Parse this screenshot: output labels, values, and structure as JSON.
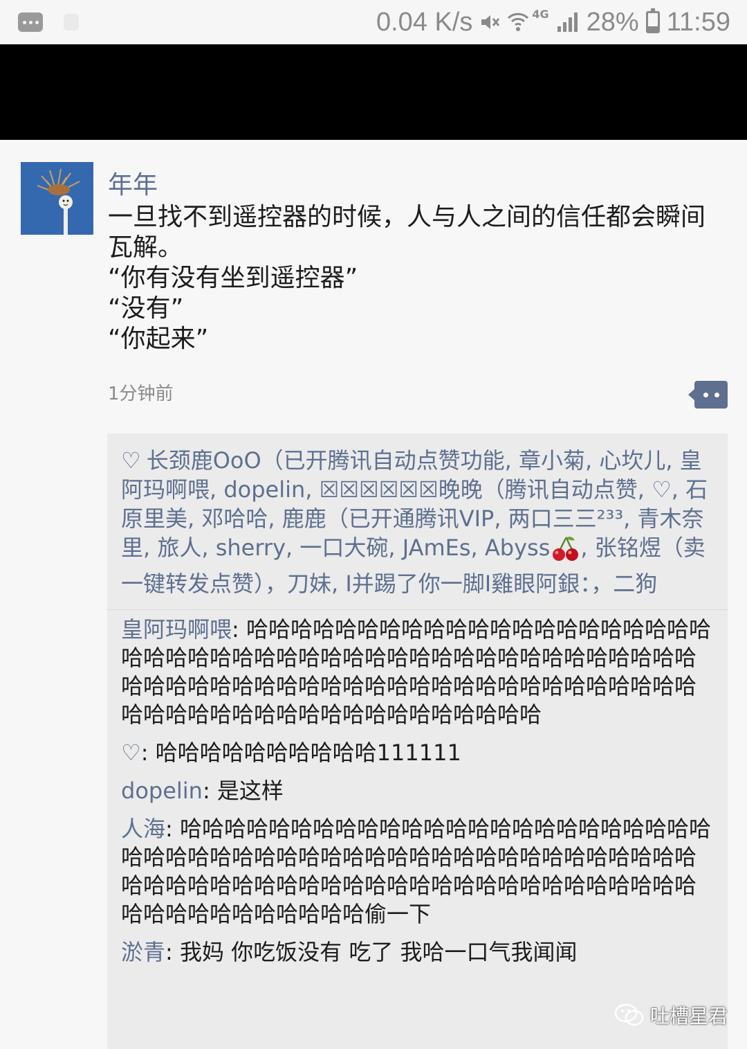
{
  "status_bar": {
    "net_speed": "0.04 K/s",
    "network": "4G",
    "battery": "28%",
    "battery_level": 0.28,
    "time": "11:59"
  },
  "post": {
    "author": "年年",
    "text": "一旦找不到遥控器的时候，人与人之间的信任都会瞬间瓦解。\n“你有没有坐到遥控器”\n“没有”\n“你起来”",
    "time": "1分钟前"
  },
  "likes": {
    "text": "长颈鹿OoO（已开腾讯自动点赞功能, 章小菊, 心坎儿, 皇阿玛啊喂, dopelin, ☒☒☒☒☒☒晚晚（腾讯自动点赞, ♡, 石原里美, 邓哈哈, 鹿鹿（已开通腾讯VIP, 两口三三²³³, 青木奈里, 旅人, sherry, 一口大碗, JAmEs, Abyss",
    "text_after_emoji": ", 张铭煜（卖一键转发点赞），刀妹, I并踢了你一脚I雞眼阿銀：，二狗"
  },
  "comments": [
    {
      "name": "皇阿玛啊喂",
      "text": ": 哈哈哈哈哈哈哈哈哈哈哈哈哈哈哈哈哈哈哈哈哈哈哈哈哈哈哈哈哈哈哈哈哈哈哈哈哈哈哈哈哈哈哈哈哈哈哈哈哈哈哈哈哈哈哈哈哈哈哈哈哈哈哈哈哈哈哈哈哈哈哈哈哈哈哈哈哈哈哈哈哈哈哈哈哈哈哈哈哈哈哈哈"
    },
    {
      "name": "♡",
      "text": ": 哈哈哈哈哈哈哈哈哈哈111111"
    },
    {
      "name": "dopelin",
      "text": ": 是这样"
    },
    {
      "name": "人海",
      "text": ": 哈哈哈哈哈哈哈哈哈哈哈哈哈哈哈哈哈哈哈哈哈哈哈哈哈哈哈哈哈哈哈哈哈哈哈哈哈哈哈哈哈哈哈哈哈哈哈哈哈哈哈哈哈哈哈哈哈哈哈哈哈哈哈哈哈哈哈哈哈哈哈哈哈哈哈哈哈哈哈哈哈哈哈哈哈哈哈偷一下"
    },
    {
      "name": "淤青",
      "text": ": 我妈 你吃饭没有  吃了  我哈一口气我闻闻"
    }
  ],
  "watermark": "吐槽星君"
}
